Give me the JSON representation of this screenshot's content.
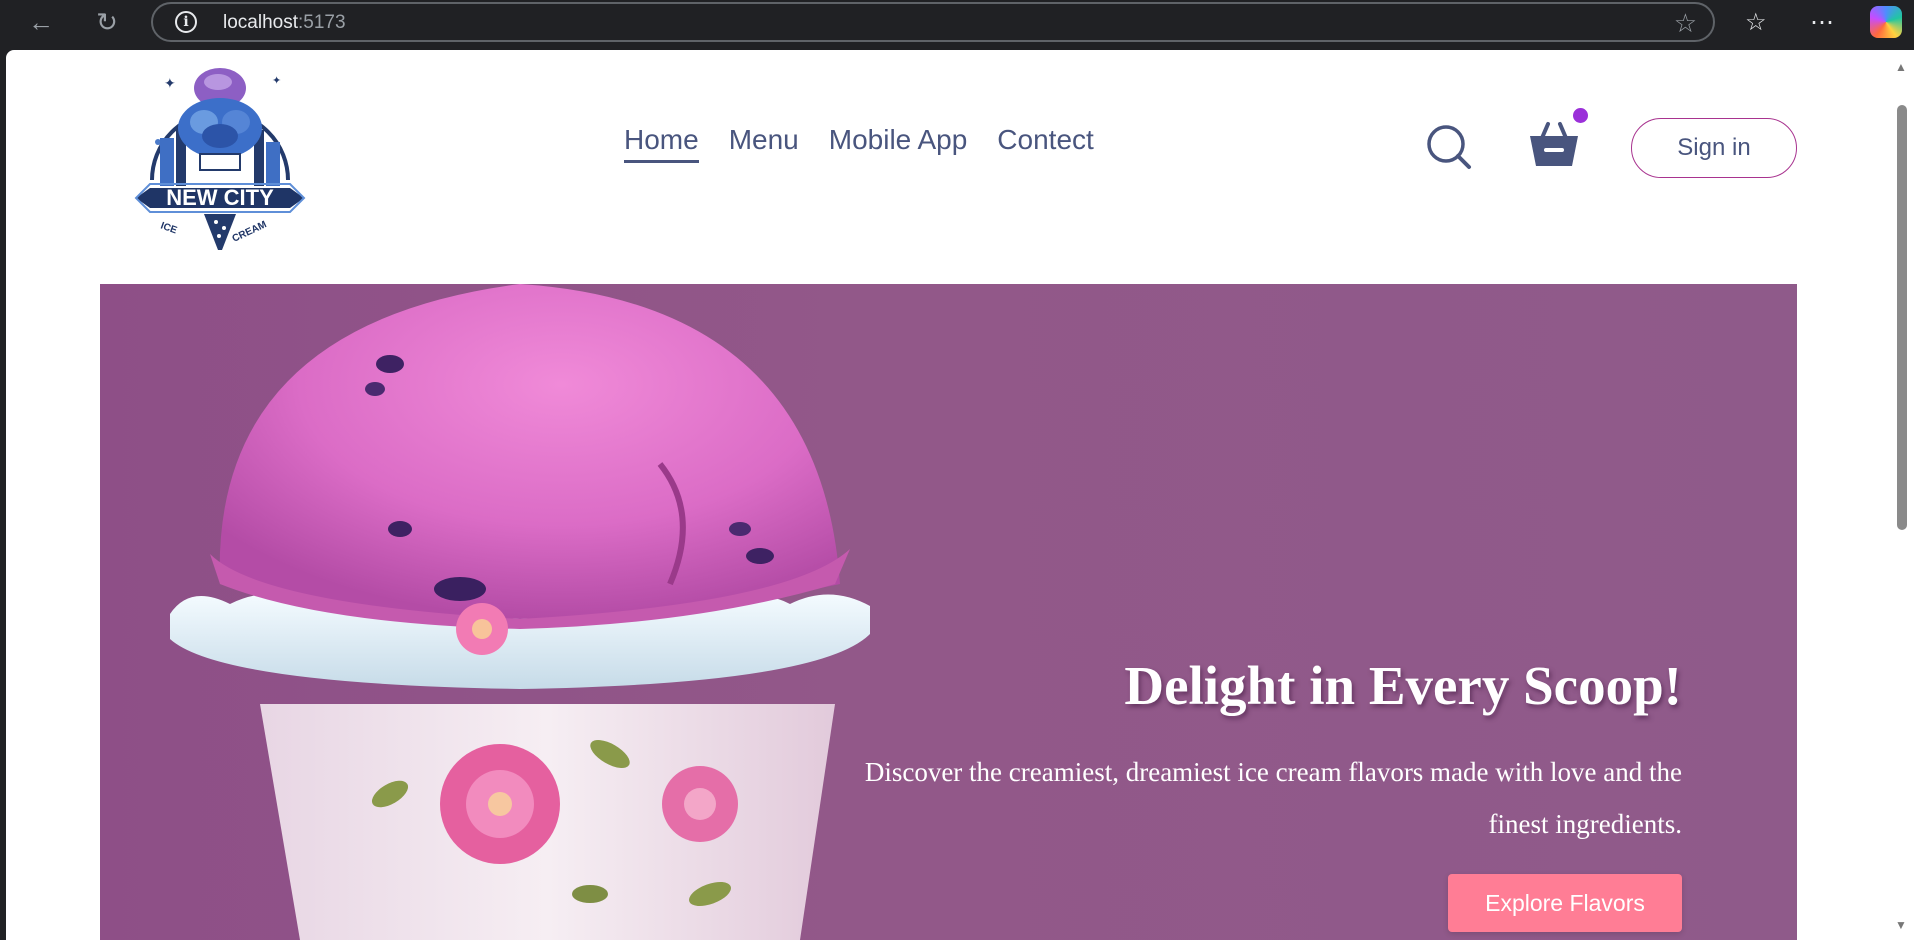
{
  "browser": {
    "url_host": "localhost",
    "url_port": ":5173"
  },
  "header": {
    "logo": {
      "line1": "NEW CITY",
      "line2": "ICE CREAM"
    },
    "nav": [
      {
        "label": "Home",
        "active": true
      },
      {
        "label": "Menu",
        "active": false
      },
      {
        "label": "Mobile App",
        "active": false
      },
      {
        "label": "Contect",
        "active": false
      }
    ],
    "signin_label": "Sign in"
  },
  "hero": {
    "title": "Delight in Every Scoop!",
    "subtitle": "Discover the creamiest, dreamiest ice cream flavors made with love and the finest ingredients.",
    "button_label": "Explore Flavors"
  },
  "colors": {
    "nav_text": "#49557e",
    "accent_border": "#a8338f",
    "cart_dot": "#9b30d9",
    "hero_bg": "#8e4f87",
    "hero_button": "#ff7d95"
  }
}
